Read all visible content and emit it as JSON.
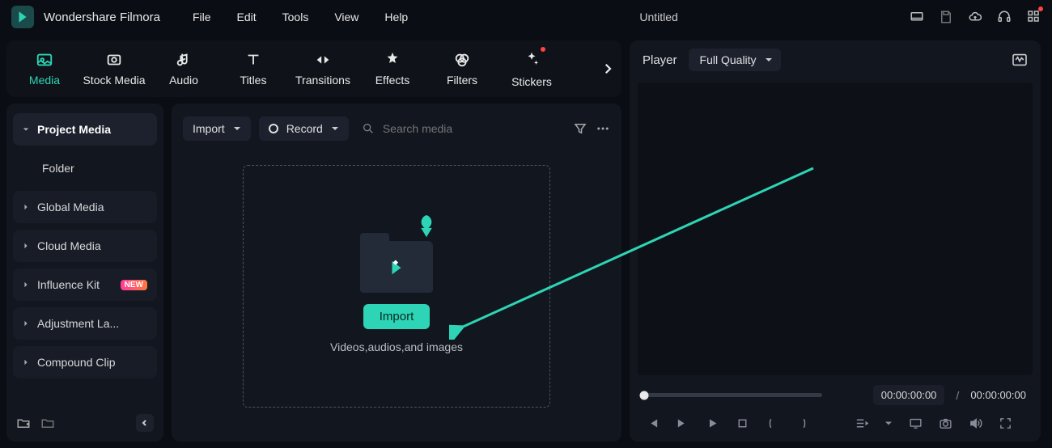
{
  "app": {
    "title": "Wondershare Filmora",
    "doc_title": "Untitled"
  },
  "menu": {
    "file": "File",
    "edit": "Edit",
    "tools": "Tools",
    "view": "View",
    "help": "Help"
  },
  "tabs": {
    "media": "Media",
    "stock": "Stock Media",
    "audio": "Audio",
    "titles": "Titles",
    "transitions": "Transitions",
    "effects": "Effects",
    "filters": "Filters",
    "stickers": "Stickers"
  },
  "sidebar": {
    "project_media": "Project Media",
    "folder": "Folder",
    "global_media": "Global Media",
    "cloud_media": "Cloud Media",
    "influence_kit": "Influence Kit",
    "influence_badge": "NEW",
    "adjustment": "Adjustment La...",
    "compound": "Compound Clip"
  },
  "toolbar": {
    "import": "Import",
    "record": "Record",
    "search_placeholder": "Search media"
  },
  "dropzone": {
    "button": "Import",
    "hint": "Videos,audios,and images"
  },
  "player": {
    "label": "Player",
    "quality": "Full Quality",
    "time_current": "00:00:00:00",
    "time_sep": "/",
    "time_total": "00:00:00:00"
  }
}
